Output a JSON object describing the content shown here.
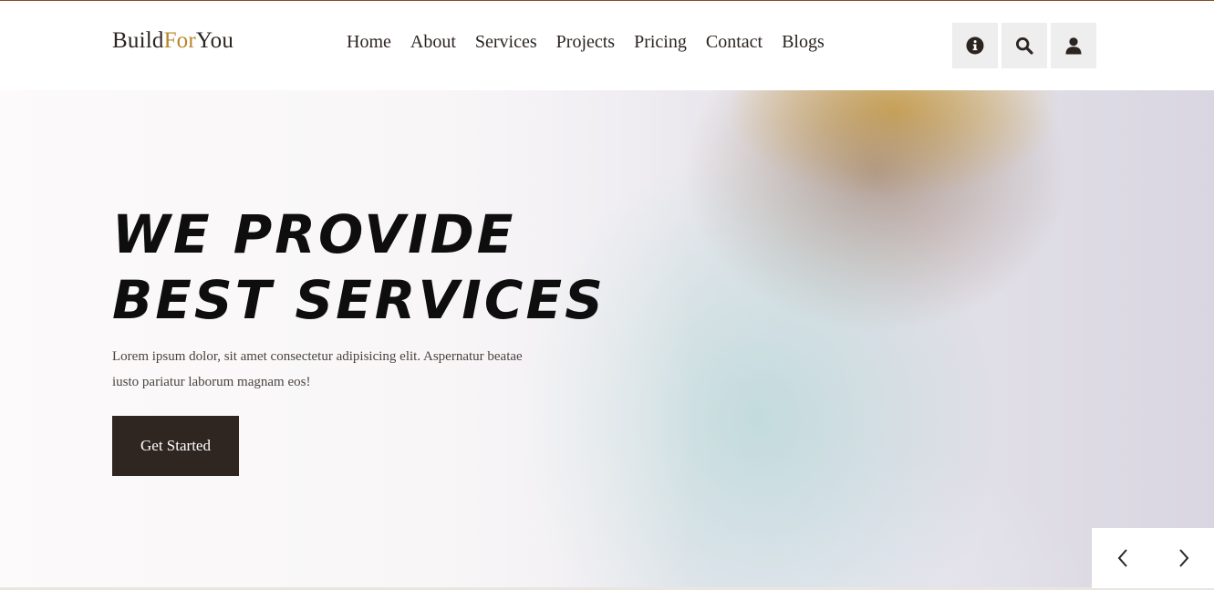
{
  "logo": {
    "part1": "Build",
    "part2": "For",
    "part3": "You"
  },
  "nav": [
    "Home",
    "About",
    "Services",
    "Projects",
    "Pricing",
    "Contact",
    "Blogs"
  ],
  "header_icons": [
    "info-icon",
    "search-icon",
    "user-icon"
  ],
  "hero": {
    "title_line1": "WE PROVIDE",
    "title_line2": "BEST SERVICES",
    "description": "Lorem ipsum dolor, sit amet consectetur adipisicing elit. Aspernatur beatae iusto pariatur laborum magnam eos!",
    "cta_label": "Get Started"
  },
  "slider_icons": [
    "chevron-left-icon",
    "chevron-right-icon"
  ],
  "colors": {
    "accent": "#b8862b",
    "dark": "#2f2622",
    "text": "#2b2421"
  }
}
